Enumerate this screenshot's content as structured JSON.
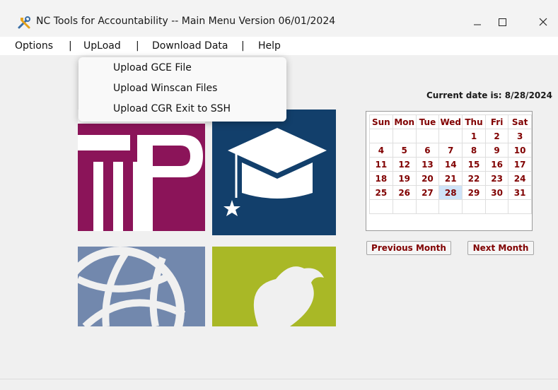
{
  "window": {
    "title": "NC Tools for Accountability -- Main Menu Version 06/01/2024",
    "minimize_icon": "minimize-icon",
    "maximize_icon": "maximize-icon",
    "close_icon": "close-icon"
  },
  "menubar": {
    "items": [
      "Options",
      "UpLoad",
      "Download Data",
      "Help"
    ],
    "separator": "|"
  },
  "upload_menu": {
    "items": [
      "Upload GCE File",
      "Upload Winscan Files",
      "Upload CGR Exit to SSH"
    ]
  },
  "calendar": {
    "current_date_text": "Current date is: 8/28/2024",
    "weekdays": [
      "Sun",
      "Mon",
      "Tue",
      "Wed",
      "Thu",
      "Fri",
      "Sat"
    ],
    "weeks": [
      [
        "",
        "",
        "",
        "",
        "1",
        "2",
        "3"
      ],
      [
        "4",
        "5",
        "6",
        "7",
        "8",
        "9",
        "10"
      ],
      [
        "11",
        "12",
        "13",
        "14",
        "15",
        "16",
        "17"
      ],
      [
        "18",
        "19",
        "20",
        "21",
        "22",
        "23",
        "24"
      ],
      [
        "25",
        "26",
        "27",
        "28",
        "29",
        "30",
        "31"
      ],
      [
        "",
        "",
        "",
        "",
        "",
        "",
        ""
      ]
    ],
    "selected_day": "28",
    "prev_button": "Previous Month",
    "next_button": "Next Month",
    "text_color": "#800000"
  },
  "logo": {
    "colors": {
      "magenta": "#8b1459",
      "navy": "#123f6b",
      "slate": "#7288ad",
      "lime": "#a9b826"
    }
  }
}
